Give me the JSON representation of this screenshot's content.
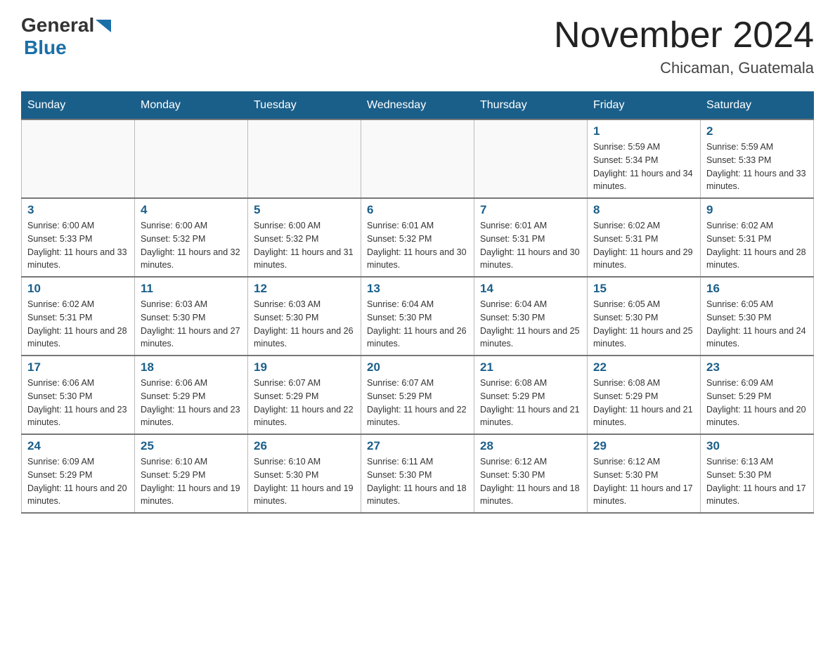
{
  "logo": {
    "general": "General",
    "blue": "Blue"
  },
  "header": {
    "month_title": "November 2024",
    "location": "Chicaman, Guatemala"
  },
  "days_of_week": [
    "Sunday",
    "Monday",
    "Tuesday",
    "Wednesday",
    "Thursday",
    "Friday",
    "Saturday"
  ],
  "weeks": [
    [
      {
        "day": "",
        "sunrise": "",
        "sunset": "",
        "daylight": ""
      },
      {
        "day": "",
        "sunrise": "",
        "sunset": "",
        "daylight": ""
      },
      {
        "day": "",
        "sunrise": "",
        "sunset": "",
        "daylight": ""
      },
      {
        "day": "",
        "sunrise": "",
        "sunset": "",
        "daylight": ""
      },
      {
        "day": "",
        "sunrise": "",
        "sunset": "",
        "daylight": ""
      },
      {
        "day": "1",
        "sunrise": "Sunrise: 5:59 AM",
        "sunset": "Sunset: 5:34 PM",
        "daylight": "Daylight: 11 hours and 34 minutes."
      },
      {
        "day": "2",
        "sunrise": "Sunrise: 5:59 AM",
        "sunset": "Sunset: 5:33 PM",
        "daylight": "Daylight: 11 hours and 33 minutes."
      }
    ],
    [
      {
        "day": "3",
        "sunrise": "Sunrise: 6:00 AM",
        "sunset": "Sunset: 5:33 PM",
        "daylight": "Daylight: 11 hours and 33 minutes."
      },
      {
        "day": "4",
        "sunrise": "Sunrise: 6:00 AM",
        "sunset": "Sunset: 5:32 PM",
        "daylight": "Daylight: 11 hours and 32 minutes."
      },
      {
        "day": "5",
        "sunrise": "Sunrise: 6:00 AM",
        "sunset": "Sunset: 5:32 PM",
        "daylight": "Daylight: 11 hours and 31 minutes."
      },
      {
        "day": "6",
        "sunrise": "Sunrise: 6:01 AM",
        "sunset": "Sunset: 5:32 PM",
        "daylight": "Daylight: 11 hours and 30 minutes."
      },
      {
        "day": "7",
        "sunrise": "Sunrise: 6:01 AM",
        "sunset": "Sunset: 5:31 PM",
        "daylight": "Daylight: 11 hours and 30 minutes."
      },
      {
        "day": "8",
        "sunrise": "Sunrise: 6:02 AM",
        "sunset": "Sunset: 5:31 PM",
        "daylight": "Daylight: 11 hours and 29 minutes."
      },
      {
        "day": "9",
        "sunrise": "Sunrise: 6:02 AM",
        "sunset": "Sunset: 5:31 PM",
        "daylight": "Daylight: 11 hours and 28 minutes."
      }
    ],
    [
      {
        "day": "10",
        "sunrise": "Sunrise: 6:02 AM",
        "sunset": "Sunset: 5:31 PM",
        "daylight": "Daylight: 11 hours and 28 minutes."
      },
      {
        "day": "11",
        "sunrise": "Sunrise: 6:03 AM",
        "sunset": "Sunset: 5:30 PM",
        "daylight": "Daylight: 11 hours and 27 minutes."
      },
      {
        "day": "12",
        "sunrise": "Sunrise: 6:03 AM",
        "sunset": "Sunset: 5:30 PM",
        "daylight": "Daylight: 11 hours and 26 minutes."
      },
      {
        "day": "13",
        "sunrise": "Sunrise: 6:04 AM",
        "sunset": "Sunset: 5:30 PM",
        "daylight": "Daylight: 11 hours and 26 minutes."
      },
      {
        "day": "14",
        "sunrise": "Sunrise: 6:04 AM",
        "sunset": "Sunset: 5:30 PM",
        "daylight": "Daylight: 11 hours and 25 minutes."
      },
      {
        "day": "15",
        "sunrise": "Sunrise: 6:05 AM",
        "sunset": "Sunset: 5:30 PM",
        "daylight": "Daylight: 11 hours and 25 minutes."
      },
      {
        "day": "16",
        "sunrise": "Sunrise: 6:05 AM",
        "sunset": "Sunset: 5:30 PM",
        "daylight": "Daylight: 11 hours and 24 minutes."
      }
    ],
    [
      {
        "day": "17",
        "sunrise": "Sunrise: 6:06 AM",
        "sunset": "Sunset: 5:30 PM",
        "daylight": "Daylight: 11 hours and 23 minutes."
      },
      {
        "day": "18",
        "sunrise": "Sunrise: 6:06 AM",
        "sunset": "Sunset: 5:29 PM",
        "daylight": "Daylight: 11 hours and 23 minutes."
      },
      {
        "day": "19",
        "sunrise": "Sunrise: 6:07 AM",
        "sunset": "Sunset: 5:29 PM",
        "daylight": "Daylight: 11 hours and 22 minutes."
      },
      {
        "day": "20",
        "sunrise": "Sunrise: 6:07 AM",
        "sunset": "Sunset: 5:29 PM",
        "daylight": "Daylight: 11 hours and 22 minutes."
      },
      {
        "day": "21",
        "sunrise": "Sunrise: 6:08 AM",
        "sunset": "Sunset: 5:29 PM",
        "daylight": "Daylight: 11 hours and 21 minutes."
      },
      {
        "day": "22",
        "sunrise": "Sunrise: 6:08 AM",
        "sunset": "Sunset: 5:29 PM",
        "daylight": "Daylight: 11 hours and 21 minutes."
      },
      {
        "day": "23",
        "sunrise": "Sunrise: 6:09 AM",
        "sunset": "Sunset: 5:29 PM",
        "daylight": "Daylight: 11 hours and 20 minutes."
      }
    ],
    [
      {
        "day": "24",
        "sunrise": "Sunrise: 6:09 AM",
        "sunset": "Sunset: 5:29 PM",
        "daylight": "Daylight: 11 hours and 20 minutes."
      },
      {
        "day": "25",
        "sunrise": "Sunrise: 6:10 AM",
        "sunset": "Sunset: 5:29 PM",
        "daylight": "Daylight: 11 hours and 19 minutes."
      },
      {
        "day": "26",
        "sunrise": "Sunrise: 6:10 AM",
        "sunset": "Sunset: 5:30 PM",
        "daylight": "Daylight: 11 hours and 19 minutes."
      },
      {
        "day": "27",
        "sunrise": "Sunrise: 6:11 AM",
        "sunset": "Sunset: 5:30 PM",
        "daylight": "Daylight: 11 hours and 18 minutes."
      },
      {
        "day": "28",
        "sunrise": "Sunrise: 6:12 AM",
        "sunset": "Sunset: 5:30 PM",
        "daylight": "Daylight: 11 hours and 18 minutes."
      },
      {
        "day": "29",
        "sunrise": "Sunrise: 6:12 AM",
        "sunset": "Sunset: 5:30 PM",
        "daylight": "Daylight: 11 hours and 17 minutes."
      },
      {
        "day": "30",
        "sunrise": "Sunrise: 6:13 AM",
        "sunset": "Sunset: 5:30 PM",
        "daylight": "Daylight: 11 hours and 17 minutes."
      }
    ]
  ]
}
